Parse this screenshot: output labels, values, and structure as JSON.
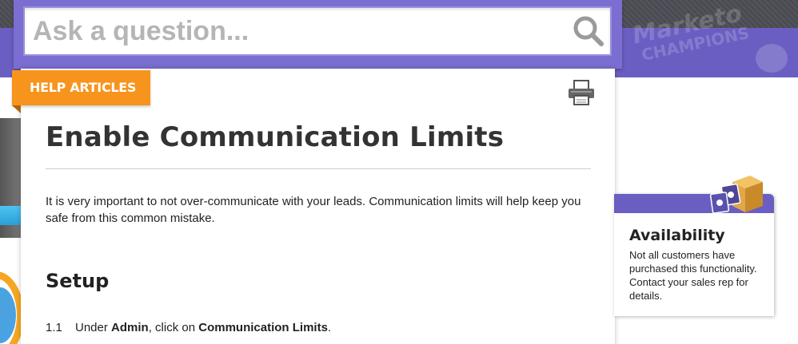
{
  "search": {
    "placeholder": "Ask a question..."
  },
  "branding": {
    "champions_line1": "Marketo",
    "champions_line2": "CHAMPIONS"
  },
  "article": {
    "tag_label": "HELP ARTICLES",
    "title": "Enable Communication Limits",
    "intro": "It is very important to not over-communicate with your leads. Communication limits will help keep you safe from this common mistake.",
    "section_heading": "Setup",
    "steps": [
      {
        "number": "1.1",
        "text_before": "Under ",
        "bold1": "Admin",
        "text_middle": ", click on ",
        "bold2": "Communication Limits",
        "text_after": "."
      }
    ]
  },
  "availability": {
    "title": "Availability",
    "text": "Not all customers have purchased this functionality. Contact your sales rep for details."
  },
  "icons": {
    "search": "search-icon",
    "print": "printer-icon",
    "availability": "product-box-icon"
  },
  "colors": {
    "brand_purple": "#6a5ec2",
    "tag_orange": "#f7941d",
    "topbar": "#4a4a52"
  }
}
